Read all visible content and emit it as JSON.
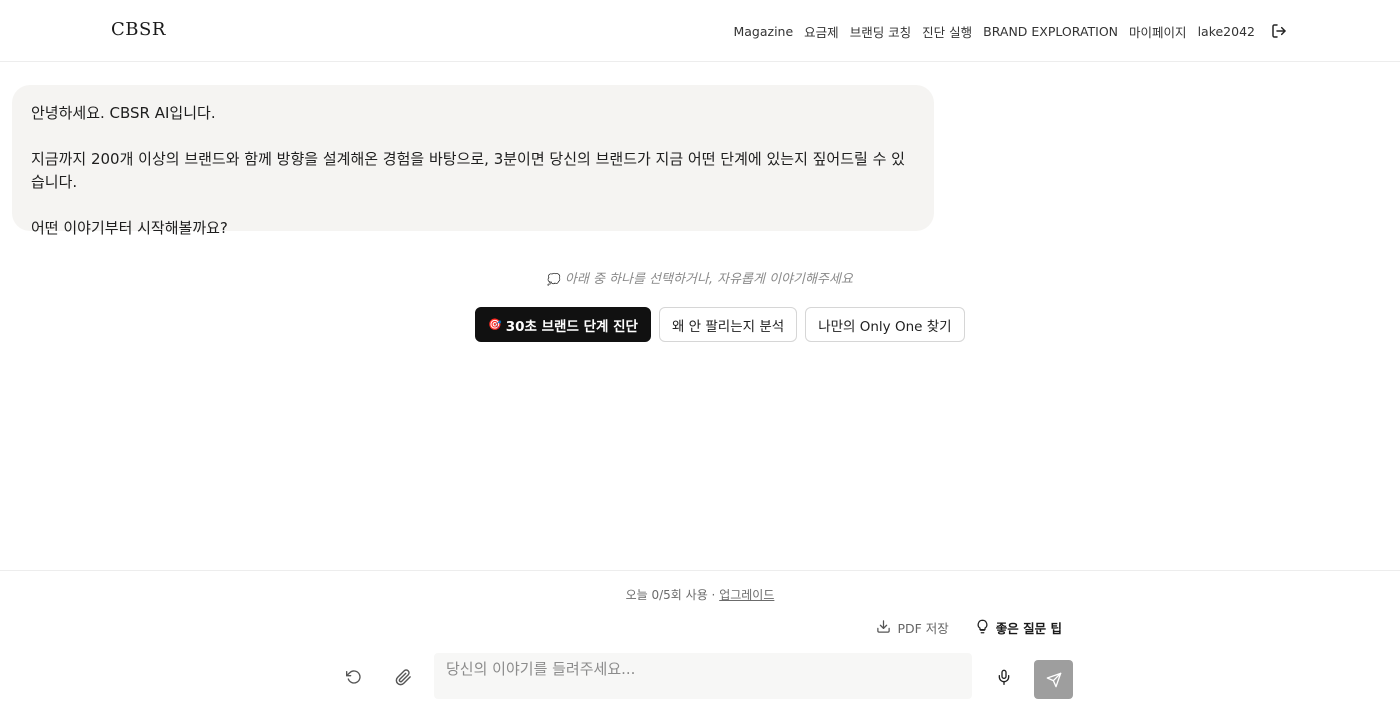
{
  "header": {
    "logo": "CBSR",
    "nav": {
      "magazine": "Magazine",
      "pricing": "요금제",
      "coaching": "브랜딩 코칭",
      "diagnosis": "진단 실행",
      "exploration": "BRAND EXPLORATION",
      "mypage": "마이페이지",
      "username": "lake2042"
    }
  },
  "chat": {
    "message": {
      "line1": "안녕하세요. CBSR AI입니다.",
      "line2": "지금까지 200개 이상의 브랜드와 함께 방향을 설계해온 경험을 바탕으로, 3분이면 당신의 브랜드가 지금 어떤 단계에 있는지 짚어드릴 수 있습니다.",
      "line3": "어떤 이야기부터 시작해볼까요?"
    },
    "hint_icon": "💭",
    "hint": "아래 중 하나를 선택하거나, 자유롭게 이야기해주세요",
    "suggestions": {
      "primary_icon": "🎯",
      "primary": "30초 브랜드 단계 진단",
      "second": "왜 안 팔리는지 분석",
      "third": "나만의 Only One 찾기"
    }
  },
  "footer": {
    "usage_text": "오늘 0/5회 사용 · ",
    "upgrade": "업그레이드",
    "pdf": "PDF 저장",
    "tips": "좋은 질문 팁",
    "input_placeholder": "당신의 이야기를 들려주세요..."
  },
  "icons": {
    "logout": "logout-icon",
    "reset": "reset-icon",
    "attach": "paperclip-icon",
    "mic": "microphone-icon",
    "send": "send-icon",
    "download": "download-icon",
    "lightbulb": "lightbulb-icon"
  }
}
